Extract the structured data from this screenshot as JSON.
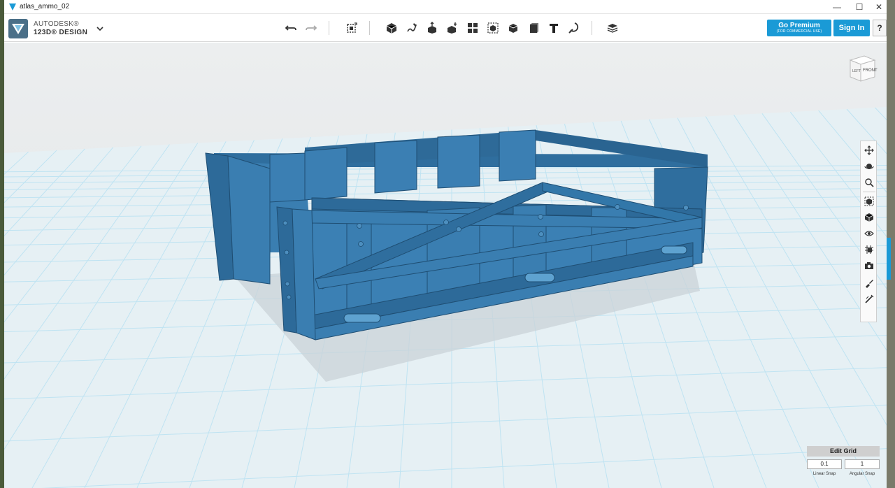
{
  "window": {
    "title": "atlas_ammo_02",
    "minimize": "—",
    "maximize": "☐",
    "close": "✕"
  },
  "brand": {
    "line1": "AUTODESK®",
    "line2": "123D® DESIGN"
  },
  "toolbar": {
    "buttons": [
      "undo",
      "redo",
      "transform",
      "primitives",
      "sketch",
      "construct",
      "modify",
      "pattern",
      "group",
      "combine",
      "measure",
      "text",
      "snap",
      "material"
    ]
  },
  "account": {
    "premium_label": "Go Premium",
    "premium_sub": "(FOR COMMERCIAL USE)",
    "signin_label": "Sign In",
    "help_label": "?"
  },
  "viewcube": {
    "left": "LEFT",
    "front": "FRONT"
  },
  "grid": {
    "edit_label": "Edit Grid",
    "linear_snap_value": "0.1",
    "angular_snap_value": "1",
    "linear_snap_label": "Linear Snap",
    "angular_snap_label": "Angular Snap"
  },
  "colors": {
    "accent": "#1a9ad6",
    "model": "#3a7eb1",
    "grid_line": "#bfe3f2",
    "grid_bg": "#e3eef3"
  }
}
